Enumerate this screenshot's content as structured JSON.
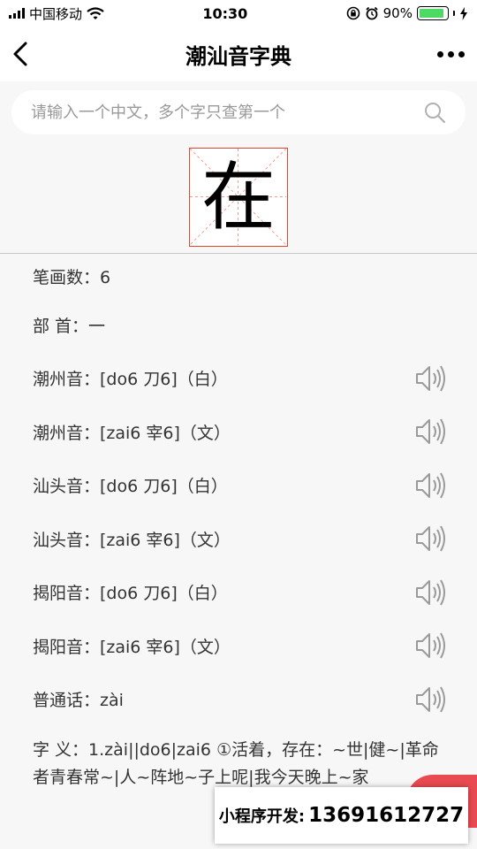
{
  "status_bar": {
    "carrier": "中国移动",
    "time": "10:30",
    "battery_pct": "90%",
    "battery_level": 0.9
  },
  "nav": {
    "title": "潮汕音字典"
  },
  "search": {
    "placeholder": "请输入一个中文，多个字只查第一个",
    "value": ""
  },
  "character": "在",
  "info": {
    "strokes": "笔画数：6",
    "radical": "部 首：一",
    "readings": [
      "潮州音：[do6 刀6]（白）",
      "潮州音：[zai6 宰6]（文）",
      "汕头音：[do6 刀6]（白）",
      "汕头音：[zai6 宰6]（文）",
      "揭阳音：[do6 刀6]（白）",
      "揭阳音：[zai6 宰6]（文）",
      "普通话：zài"
    ],
    "meaning": "字 义：1.zài||do6|zai6 ①活着，存在：~世|健~|革命者青春常~|人~阵地~子上呢|我今天晚上~家"
  },
  "promo": {
    "label": "小程序开发:",
    "phone": "13691612727"
  },
  "colors": {
    "grid_border": "#e0462a",
    "battery": "#4cd964",
    "promo_tab": "#e94a52"
  }
}
